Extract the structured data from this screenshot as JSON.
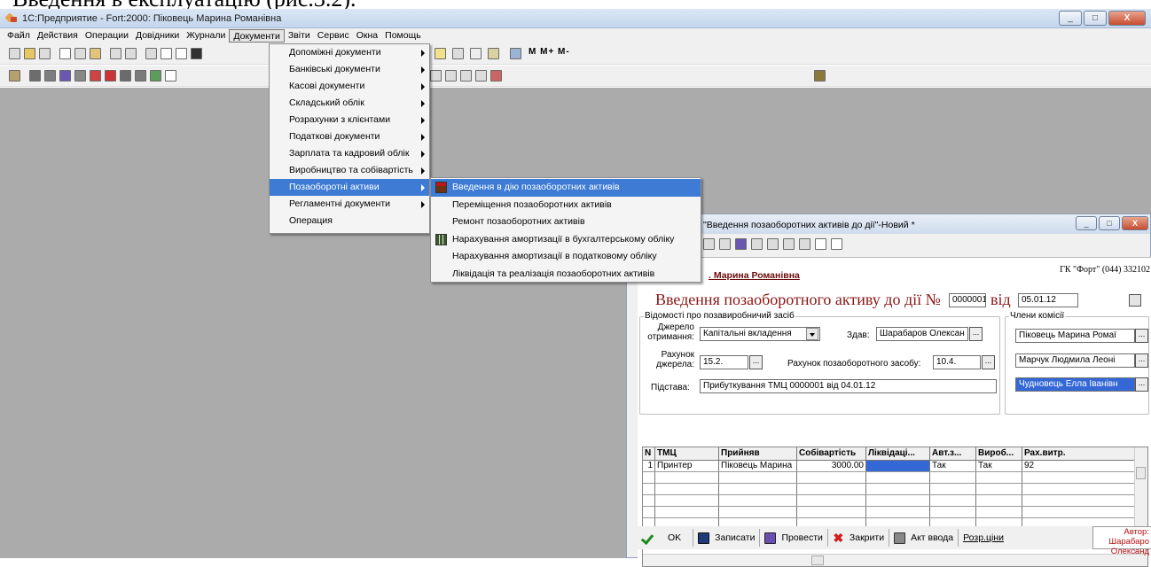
{
  "heading_fragment": "Введення в експлуатацію (рис.3.2).",
  "window": {
    "title": "1С:Предприятие - Fort:2000: Піковець Марина Романівна",
    "controls": [
      "_",
      "□",
      "X"
    ]
  },
  "menubar": [
    "Файл",
    "Действия",
    "Операции",
    "Довідники",
    "Журнали",
    "Документи",
    "Звіти",
    "Сервис",
    "Окна",
    "Помощь"
  ],
  "toolbar_text": "M  M+  M-",
  "documents_menu": [
    {
      "label": "Допоміжні документи",
      "sub": true
    },
    {
      "label": "Банківські документи",
      "sub": true
    },
    {
      "label": "Касові документи",
      "sub": true
    },
    {
      "label": "Складський облік",
      "sub": true
    },
    {
      "label": "Розрахунки з клієнтами",
      "sub": true
    },
    {
      "label": "Податкові документи",
      "sub": true
    },
    {
      "label": "Зарплата та кадровий облік",
      "sub": true
    },
    {
      "label": "Виробництво та собівартість",
      "sub": true
    },
    {
      "label": "Позаоборотні активи",
      "sub": true,
      "highlighted": true
    },
    {
      "label": "Регламентні документи",
      "sub": true
    },
    {
      "label": "Операция",
      "sub": false
    }
  ],
  "assets_submenu": [
    {
      "label": "Введення в дію позаоборотних активів",
      "icon": "building-icon",
      "highlighted": true
    },
    {
      "label": "Переміщення позаоборотних активів",
      "icon": ""
    },
    {
      "label": "Ремонт позаоборотних активів",
      "icon": ""
    },
    {
      "label": "Нарахування амортизації в бухгалтерському обліку",
      "icon": "table-icon"
    },
    {
      "label": "Нарахування амортизації в податковому обліку",
      "icon": ""
    },
    {
      "label": "Ліквідація та реалізація позаоборотних активів",
      "icon": ""
    }
  ],
  "dialog": {
    "title": "\"Введення позаоборотних активів до дії\"-Новий *",
    "author_fragment": ". Марина Романівна",
    "company": "ГК \"Форт\" (044) 332102",
    "form_title": "Введення позаоборотного активу до дії №",
    "number": "0000001",
    "from_label": "від",
    "date": "05.01.12",
    "group_info": "Відомості про позавиробничий засіб",
    "source_label": "Джерело отримання:",
    "source_value": "Капітальні вкладення",
    "handed_label": "Здав:",
    "handed_value": "Шарабаров Олексан",
    "account_source_label": "Рахунок джерела:",
    "account_source_value": "15.2.",
    "asset_account_label": "Рахунок позаоборотного засобу:",
    "asset_account_value": "10.4.",
    "basis_label": "Підстава:",
    "basis_value": "Прибуткування ТМЦ 0000001 від 04.01.12",
    "commission_label": "Члени комісії",
    "commission": [
      "Піковець Марина Ромаї",
      "Марчук Людмила Леоні",
      "Чудновець Елла Іванівн"
    ],
    "table": {
      "columns": [
        "N",
        "ТМЦ",
        "Прийняв",
        "Собівартість",
        "Ліквідаці...",
        "Авт.з...",
        "Вироб...",
        "Рах.витр."
      ],
      "rows": [
        [
          "1",
          "Принтер",
          "Піковець Марина",
          "3000.00",
          "",
          "Так",
          "Так",
          "92"
        ]
      ]
    },
    "buttons": {
      "ok": "OK",
      "save": "Записати",
      "post": "Провести",
      "close": "Закрити",
      "act": "Акт ввода",
      "calc": "Розр.ціни"
    },
    "autor": "Автор: Шарабаро Олександ"
  }
}
